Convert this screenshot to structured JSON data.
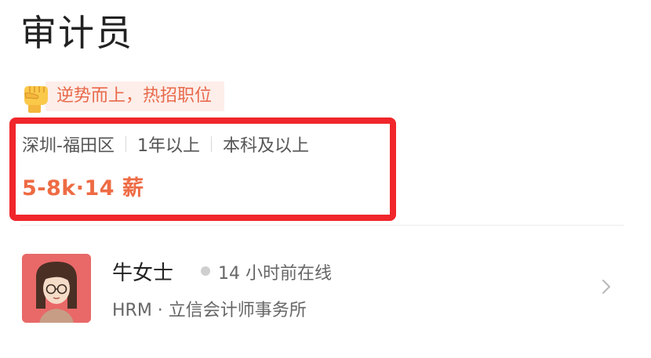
{
  "job": {
    "title": "审计员",
    "promo_badge": "逆势而上，热招职位",
    "location": "深圳-福田区",
    "experience": "1年以上",
    "education": "本科及以上",
    "salary": "5-8k·14 薪"
  },
  "recruiter": {
    "name": "牛女士",
    "online_status": "14 小时前在线",
    "company": "HRM · 立信会计师事务所"
  },
  "colors": {
    "salary": "#ee6b44",
    "promo_text": "#e8694a",
    "promo_bg": "#fdeeea",
    "highlight_border": "#f0262b",
    "avatar_bg": "#e96868"
  },
  "icons": {
    "promo": "raised-fist-icon",
    "online": "online-dot-icon",
    "navigate": "chevron-right-icon"
  }
}
